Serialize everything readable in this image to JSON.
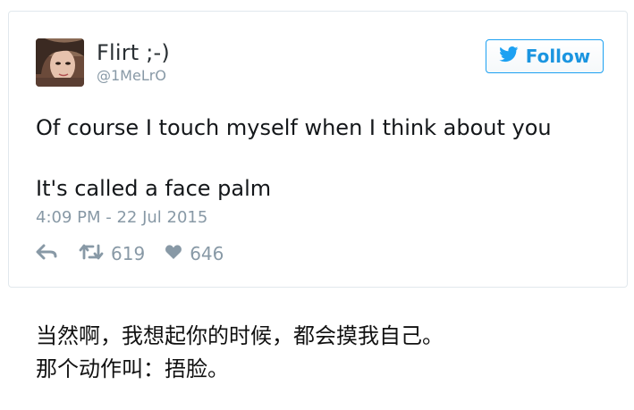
{
  "tweet": {
    "display_name": "Flirt ;-)",
    "handle": "@1MeLrO",
    "follow_label": "Follow",
    "text_line_1": "Of course I touch myself when I think about you",
    "text_line_2": "It's called a face palm",
    "timestamp": "4:09 PM - 22 Jul 2015",
    "retweet_count": "619",
    "like_count": "646",
    "icons": {
      "reply": "reply-icon",
      "retweet": "retweet-icon",
      "like": "heart-icon",
      "bird": "twitter-bird-icon"
    },
    "colors": {
      "accent": "#1da1f2",
      "muted": "#8899a6",
      "text": "#14171a",
      "border": "#e1e8ed"
    }
  },
  "caption": {
    "line_1": "当然啊，我想起你的时候，都会摸我自己。",
    "line_2": "那个动作叫：捂脸。"
  }
}
